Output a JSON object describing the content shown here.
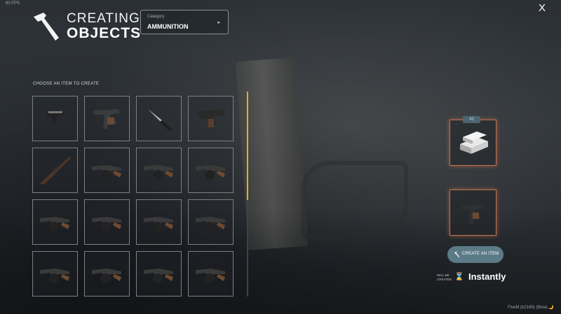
{
  "overlay": {
    "fps": "60 FPS"
  },
  "header": {
    "title_line1": "CREATING",
    "title_line2": "OBJECTS",
    "category_label": "Category",
    "category_value": "AMMUNITION",
    "category_arrow": "▸",
    "close_label": "X"
  },
  "inventory": {
    "choose_label": "CHOOSE AN ITEM TO CREATE",
    "items": [
      {
        "icon": "pistol-icon"
      },
      {
        "icon": "smg-icon"
      },
      {
        "icon": "knife-icon"
      },
      {
        "icon": "compact-smg-icon"
      },
      {
        "icon": "rifle-icon"
      },
      {
        "icon": "tommy-gun-icon"
      },
      {
        "icon": "tommy-gun-icon"
      },
      {
        "icon": "tommy-gun-icon"
      },
      {
        "icon": "tommy-gun-icon"
      },
      {
        "icon": "tommy-gun-icon"
      },
      {
        "icon": "tommy-gun-icon"
      },
      {
        "icon": "tommy-gun-icon"
      },
      {
        "icon": "tommy-gun-icon"
      },
      {
        "icon": "tommy-gun-icon"
      },
      {
        "icon": "tommy-gun-icon"
      },
      {
        "icon": "tommy-gun-icon"
      }
    ],
    "scroll_progress": 0.53,
    "scroll_color": "#e0b21d"
  },
  "recipe": {
    "ingredient_icon": "silver-bars-icon",
    "ingredient_badge": "45",
    "result_icon": "smg-icon",
    "create_button_label": "CREATE AN ITEM",
    "will_be_created": "WILL BE CREATED",
    "time_value": "Instantly",
    "hourglass_icon": "hourglass-icon",
    "accent_color": "#c17152",
    "button_color": "#5b7b87"
  },
  "footer": {
    "build_text": "FiveM (b2189) (Beta) 🌙"
  }
}
